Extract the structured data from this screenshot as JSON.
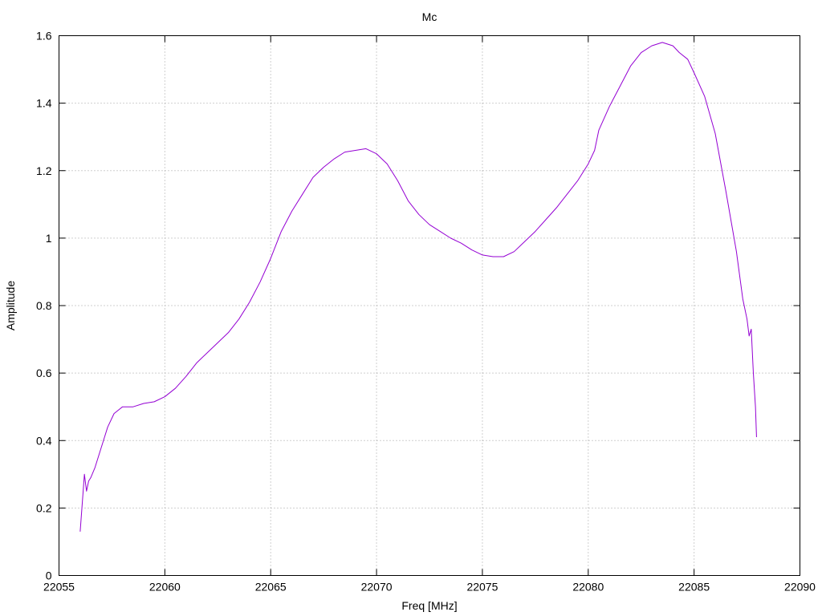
{
  "chart_data": {
    "type": "line",
    "title": "Mc",
    "xlabel": "Freq [MHz]",
    "ylabel": "Amplitude",
    "xlim": [
      22055,
      22090
    ],
    "ylim": [
      0,
      1.6
    ],
    "xticks": [
      22055,
      22060,
      22065,
      22070,
      22075,
      22080,
      22085,
      22090
    ],
    "yticks": [
      0,
      0.2,
      0.4,
      0.6,
      0.8,
      1,
      1.2,
      1.4,
      1.6
    ],
    "ytick_labels": [
      "0",
      "0.2",
      "0.4",
      "0.6",
      "0.8",
      "1",
      "1.2",
      "1.4",
      "1.6"
    ],
    "grid": true,
    "series": [
      {
        "color": "#9400d3",
        "x": [
          22056.0,
          22056.2,
          22056.3,
          22056.4,
          22056.5,
          22056.7,
          22057.0,
          22057.3,
          22057.6,
          22058.0,
          22058.5,
          22059.0,
          22059.5,
          22060.0,
          22060.5,
          22061.0,
          22061.5,
          22062.0,
          22062.5,
          22063.0,
          22063.5,
          22064.0,
          22064.5,
          22065.0,
          22065.5,
          22066.0,
          22066.5,
          22067.0,
          22067.5,
          22068.0,
          22068.5,
          22069.0,
          22069.5,
          22070.0,
          22070.5,
          22071.0,
          22071.5,
          22072.0,
          22072.5,
          22073.0,
          22073.5,
          22074.0,
          22074.5,
          22075.0,
          22075.5,
          22076.0,
          22076.5,
          22077.0,
          22077.5,
          22078.0,
          22078.5,
          22079.0,
          22079.5,
          22080.0,
          22080.3,
          22080.5,
          22081.0,
          22081.5,
          22082.0,
          22082.5,
          22083.0,
          22083.5,
          22084.0,
          22084.3,
          22084.7,
          22085.0,
          22085.5,
          22086.0,
          22086.5,
          22087.0,
          22087.3,
          22087.5,
          22087.6,
          22087.7,
          22087.8,
          22087.9,
          22087.95
        ],
        "y": [
          0.13,
          0.3,
          0.25,
          0.28,
          0.29,
          0.32,
          0.38,
          0.44,
          0.48,
          0.5,
          0.5,
          0.51,
          0.515,
          0.53,
          0.555,
          0.59,
          0.63,
          0.66,
          0.69,
          0.72,
          0.76,
          0.81,
          0.87,
          0.94,
          1.02,
          1.08,
          1.13,
          1.18,
          1.21,
          1.235,
          1.255,
          1.26,
          1.265,
          1.25,
          1.22,
          1.17,
          1.11,
          1.07,
          1.04,
          1.02,
          1.0,
          0.985,
          0.965,
          0.95,
          0.945,
          0.945,
          0.96,
          0.99,
          1.02,
          1.055,
          1.09,
          1.13,
          1.17,
          1.22,
          1.26,
          1.32,
          1.39,
          1.45,
          1.51,
          1.55,
          1.57,
          1.58,
          1.57,
          1.55,
          1.53,
          1.49,
          1.42,
          1.31,
          1.14,
          0.96,
          0.82,
          0.76,
          0.71,
          0.73,
          0.6,
          0.5,
          0.41
        ]
      }
    ]
  }
}
